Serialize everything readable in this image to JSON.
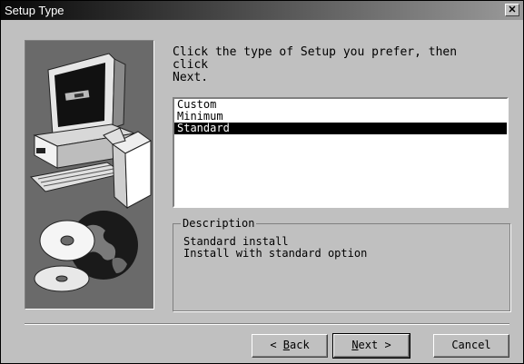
{
  "window": {
    "title": "Setup Type",
    "close_glyph": "✕"
  },
  "instruction": "Click the type of Setup you prefer, then click\nNext.",
  "setup_types": [
    {
      "label": "Custom",
      "selected": false
    },
    {
      "label": "Minimum",
      "selected": false
    },
    {
      "label": "Standard",
      "selected": true
    }
  ],
  "description": {
    "legend": "Description",
    "text": "Standard install\nInstall with standard option"
  },
  "buttons": {
    "back": {
      "pre": "< ",
      "key": "B",
      "post": "ack"
    },
    "next": {
      "key": "N",
      "post": "ext >"
    },
    "cancel": "Cancel"
  },
  "icons": {
    "art": "computer-and-cd-icon",
    "close": "close-icon"
  },
  "colors": {
    "title_start": "#080808",
    "title_end": "#9a9a9a",
    "face": "#c0c0c0",
    "selection": "#000000"
  }
}
